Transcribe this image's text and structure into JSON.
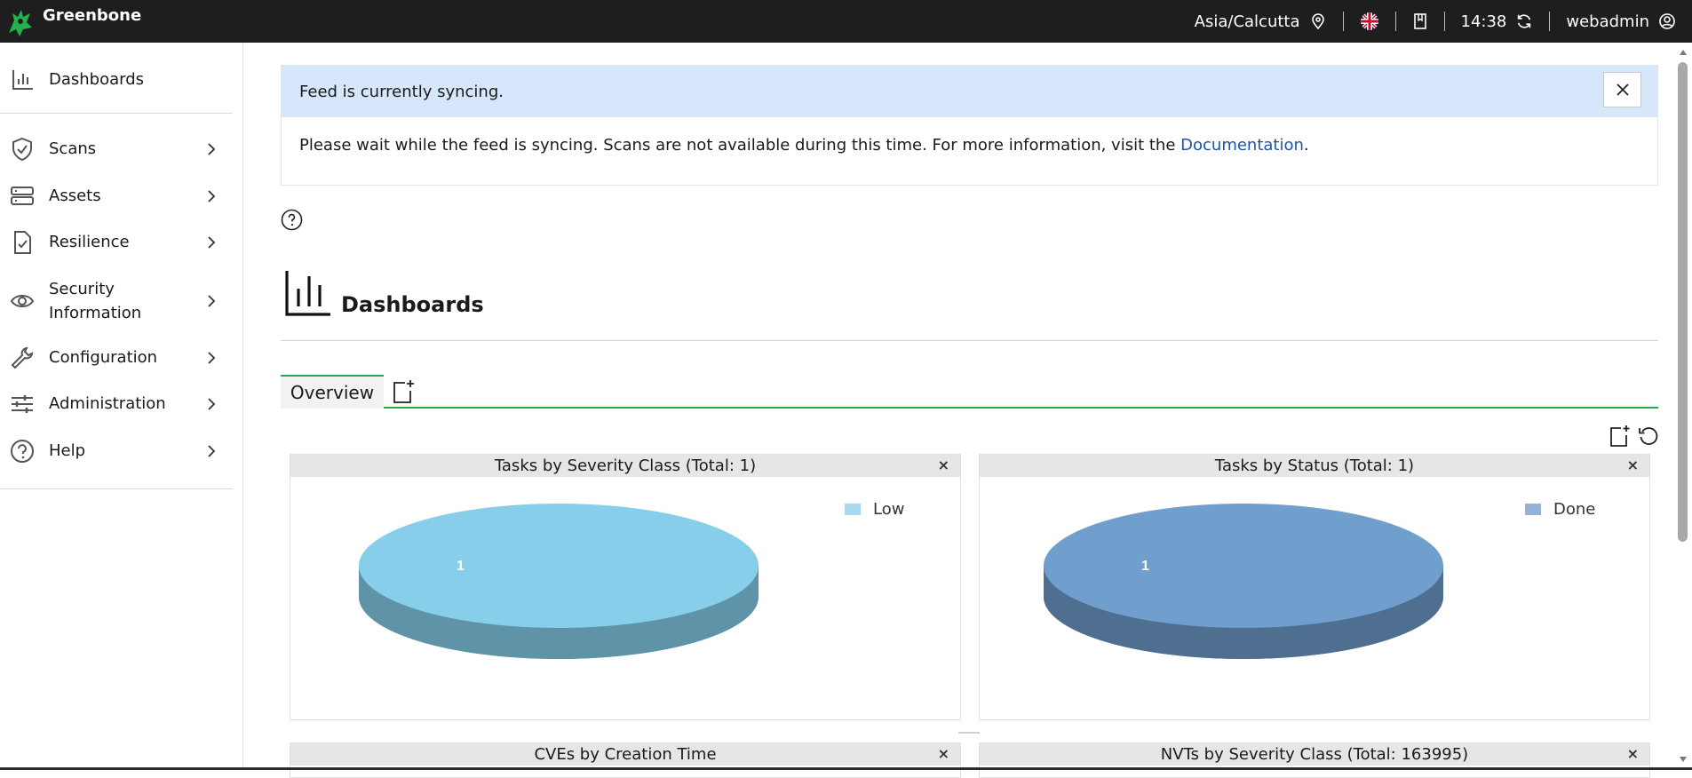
{
  "topbar": {
    "brand": "Greenbone",
    "timezone": "Asia/Calcutta",
    "time": "14:38",
    "user": "webadmin"
  },
  "sidebar": {
    "items": [
      {
        "label": "Dashboards",
        "icon": "bar-chart-icon"
      },
      {
        "label": "Scans",
        "icon": "shield-check-icon"
      },
      {
        "label": "Assets",
        "icon": "server-icon"
      },
      {
        "label": "Resilience",
        "icon": "clipboard-check-icon"
      },
      {
        "label": "Security Information",
        "icon": "eye-icon"
      },
      {
        "label": "Configuration",
        "icon": "wrench-icon"
      },
      {
        "label": "Administration",
        "icon": "sliders-icon"
      },
      {
        "label": "Help",
        "icon": "help-circle-icon"
      }
    ]
  },
  "banner": {
    "title": "Feed is currently syncing.",
    "message": "Please wait while the feed is syncing. Scans are not available during this time. For more information, visit the ",
    "link": "Documentation",
    "end": "."
  },
  "page": {
    "title": "Dashboards"
  },
  "tabs": [
    {
      "label": "Overview"
    }
  ],
  "panels": [
    {
      "title": "Tasks by Severity Class (Total: 1)",
      "legend": "Low",
      "slice_label": "1",
      "color": "#87ceeb",
      "side_color": "#5f93a8"
    },
    {
      "title": "Tasks by Status (Total: 1)",
      "legend": "Done",
      "slice_label": "1",
      "color": "#709ecd",
      "side_color": "#4f6f91"
    },
    {
      "title": "CVEs by Creation Time"
    },
    {
      "title": "NVTs by Severity Class (Total: 163995)"
    }
  ],
  "chart_data": [
    {
      "type": "pie",
      "title": "Tasks by Severity Class (Total: 1)",
      "categories": [
        "Low"
      ],
      "values": [
        1
      ]
    },
    {
      "type": "pie",
      "title": "Tasks by Status (Total: 1)",
      "categories": [
        "Done"
      ],
      "values": [
        1
      ]
    }
  ]
}
